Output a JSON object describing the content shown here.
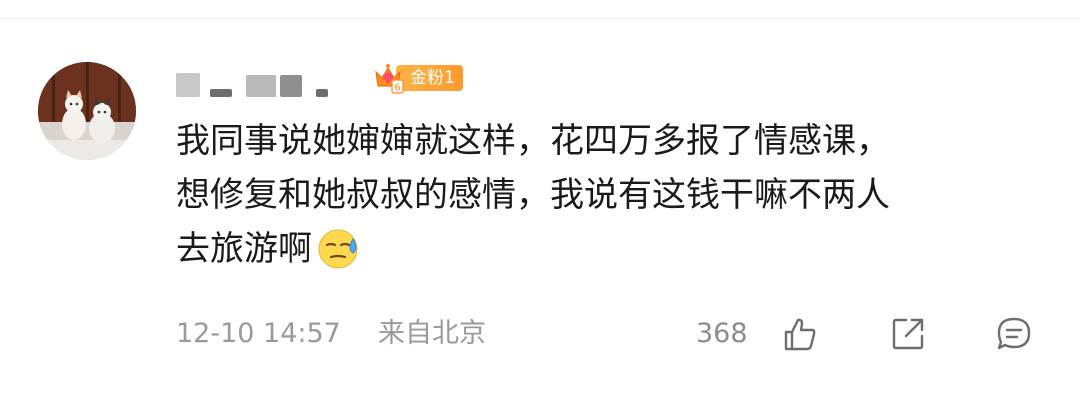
{
  "comment": {
    "username_redacted": true,
    "badge": {
      "label": "金粉1",
      "level": "6",
      "color": "#ff9a2e"
    },
    "text_lines": [
      "我同事说她婶婶就这样，花四万多报了情感课，",
      "想修复和她叔叔的感情，我说有这钱干嘛不两人",
      "去旅游啊"
    ],
    "emoji": "sweat-emoji",
    "time": "12-10 14:57",
    "location": "来自北京",
    "like_count": "368"
  },
  "icons": {
    "like": "thumbs-up-icon",
    "share": "share-icon",
    "comment": "comment-icon"
  }
}
